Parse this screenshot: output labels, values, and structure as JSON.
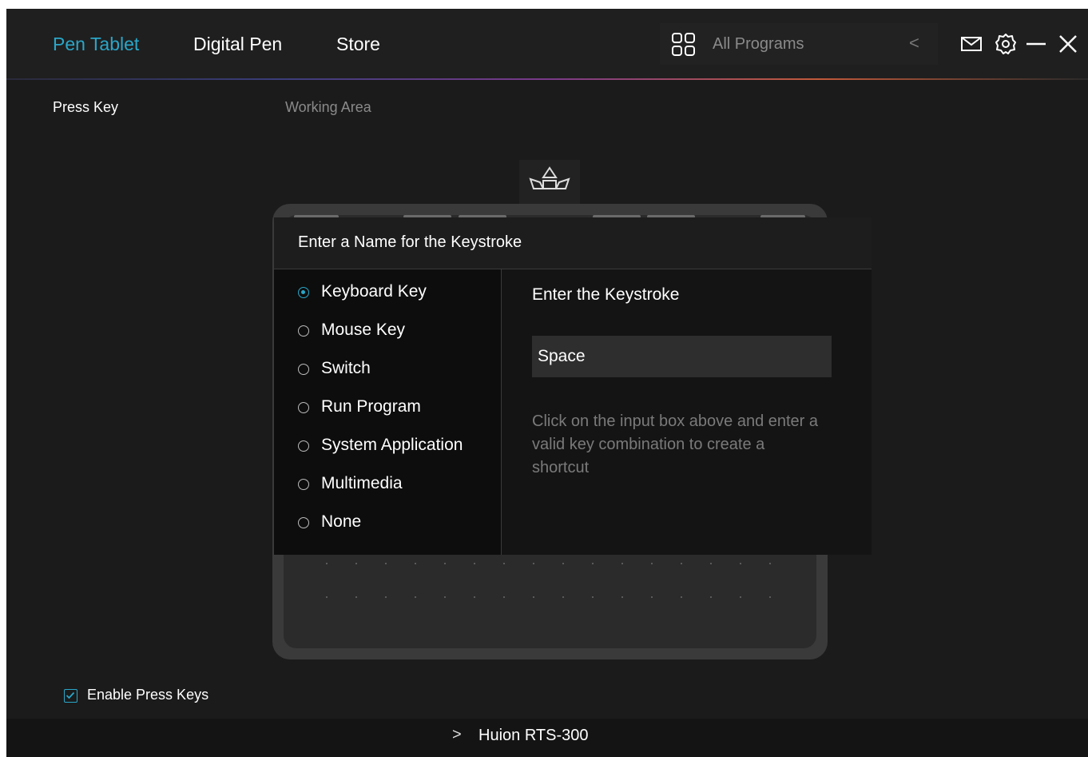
{
  "nav": {
    "tabs": [
      {
        "label": "Pen Tablet",
        "active": true
      },
      {
        "label": "Digital Pen",
        "active": false
      },
      {
        "label": "Store",
        "active": false
      }
    ],
    "program_selector": {
      "label": "All Programs",
      "icon": "grid-icon",
      "arrow": "<"
    },
    "window_icons": [
      "mail-icon",
      "gear-icon",
      "minimize-icon",
      "close-icon"
    ]
  },
  "subtabs": [
    {
      "label": "Press Key",
      "active": true
    },
    {
      "label": "Working Area",
      "active": false
    }
  ],
  "dialog": {
    "title": "Enter a Name for the Keystroke",
    "options": [
      {
        "label": "Keyboard Key",
        "checked": true
      },
      {
        "label": "Mouse Key",
        "checked": false
      },
      {
        "label": "Switch",
        "checked": false
      },
      {
        "label": "Run Program",
        "checked": false
      },
      {
        "label": "System Application",
        "checked": false
      },
      {
        "label": "Multimedia",
        "checked": false
      },
      {
        "label": "None",
        "checked": false
      }
    ],
    "keystroke_label": "Enter the Keystroke",
    "keystroke_value": "Space",
    "hint": "Click on the input box above and enter a valid key combination to create a shortcut"
  },
  "enable_press_keys": {
    "label": "Enable Press Keys",
    "checked": true
  },
  "footer": {
    "chevron": ">",
    "device_name": "Huion RTS-300"
  },
  "colors": {
    "accent": "#2aa6c8",
    "background": "#1b1b1b",
    "dialog": "#141414"
  }
}
